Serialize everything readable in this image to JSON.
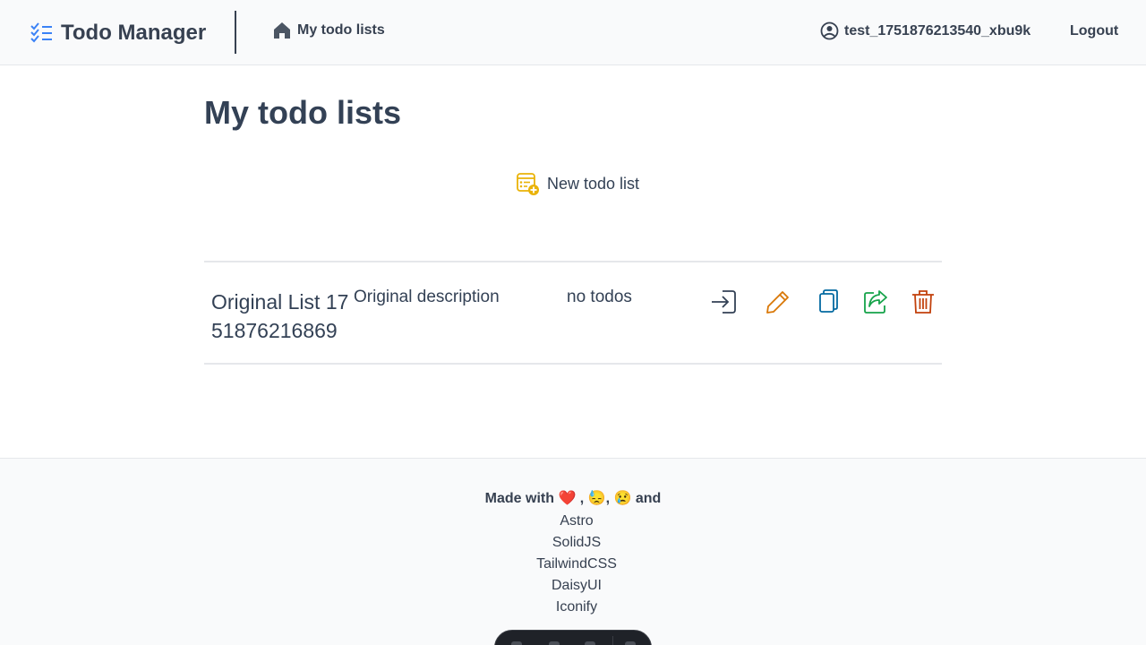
{
  "header": {
    "brand_title": "Todo Manager",
    "nav_home_label": "My todo lists",
    "username": "test_1751876213540_xbu9k",
    "logout_label": "Logout"
  },
  "main": {
    "page_title": "My todo lists",
    "new_list_label": "New todo list",
    "lists": [
      {
        "name": "Original List 1751876216869",
        "description": "Original description",
        "count_text": "no todos"
      }
    ]
  },
  "footer": {
    "made_with": "Made with ❤️ , 😓, 😢 and",
    "links": [
      "Astro",
      "SolidJS",
      "TailwindCSS",
      "DaisyUI",
      "Iconify"
    ]
  },
  "colors": {
    "text": "#374151",
    "title": "#334155",
    "accent_yellow": "#eab308",
    "edit_orange": "#d97706",
    "copy_blue": "#0369a1",
    "share_green": "#16a34a",
    "delete_red": "#c2410c"
  }
}
